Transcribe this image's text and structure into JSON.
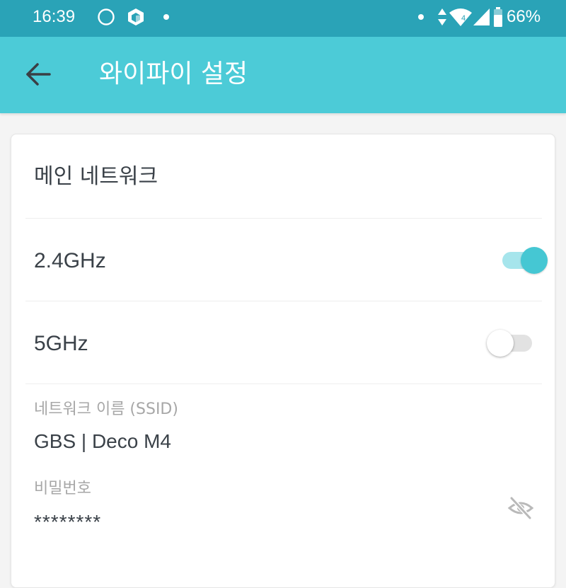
{
  "status_bar": {
    "time": "16:39",
    "battery_pct": "66%",
    "network_type": "4",
    "icons": [
      "circle-icon",
      "cube-app-icon",
      "notification-dot-icon",
      "notification-dot-icon",
      "data-arrows-icon",
      "wifi-icon",
      "cell-signal-icon",
      "battery-icon"
    ]
  },
  "app_bar": {
    "title": "와이파이 설정",
    "back_icon": "back-arrow-icon",
    "background": "#4ccbd7"
  },
  "main_network": {
    "section_title": "메인 네트워크",
    "bands": [
      {
        "label": "2.4GHz",
        "enabled": true
      },
      {
        "label": "5GHz",
        "enabled": false
      }
    ],
    "ssid": {
      "label": "네트워크 이름 (SSID)",
      "value": "GBS | Deco M4"
    },
    "password": {
      "label": "비밀번호",
      "value": "********",
      "visibility_icon": "eye-off-icon"
    }
  },
  "colors": {
    "status_bar": "#2aa3b7",
    "accent": "#45c7d3",
    "text": "#3a4148",
    "muted_text": "#a7a7a7"
  }
}
